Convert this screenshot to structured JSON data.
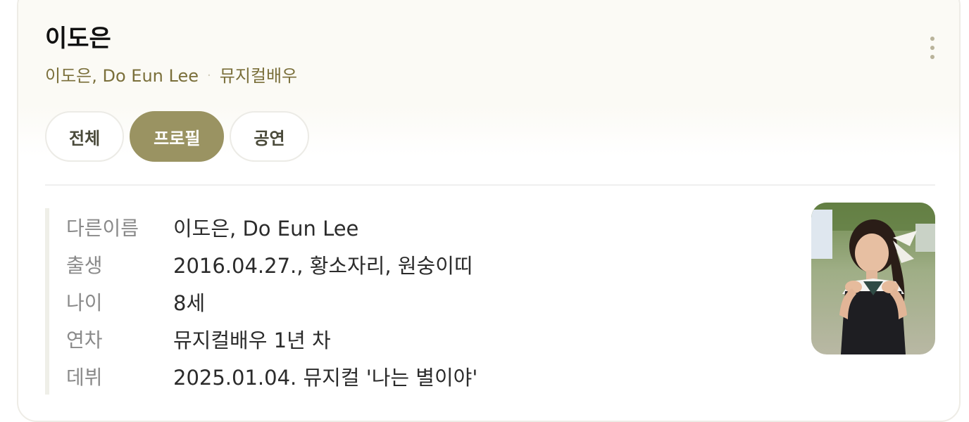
{
  "header": {
    "name": "이도은",
    "alt_names": "이도은, Do Eun Lee",
    "separator": "·",
    "occupation": "뮤지컬배우"
  },
  "tabs": [
    {
      "label": "전체",
      "active": false
    },
    {
      "label": "프로필",
      "active": true
    },
    {
      "label": "공연",
      "active": false
    }
  ],
  "profile": {
    "rows": [
      {
        "label": "다른이름",
        "value": "이도은, Do Eun Lee"
      },
      {
        "label": "출생",
        "value": "2016.04.27., 황소자리, 원숭이띠"
      },
      {
        "label": "나이",
        "value": "8세"
      },
      {
        "label": "연차",
        "value": "뮤지컬배우 1년 차"
      },
      {
        "label": "데뷔",
        "value": "2025.01.04. 뮤지컬 '나는 별이야'"
      }
    ]
  },
  "icons": {
    "more": "more-vertical-icon",
    "photo": "profile-photo"
  },
  "colors": {
    "accent": "#9a9362",
    "subtitle": "#7a6f3a",
    "header_bg": "#fbfaf5",
    "label": "#8a8a8a"
  }
}
